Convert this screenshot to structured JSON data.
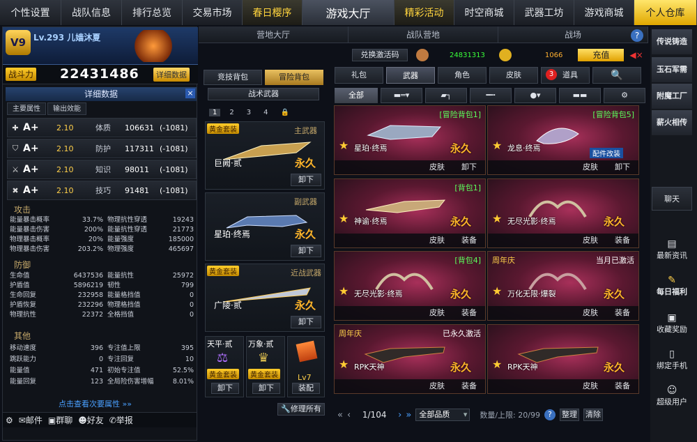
{
  "nav": [
    "个性设置",
    "战队信息",
    "排行总览",
    "交易市场",
    "春日樱序",
    "游戏大厅",
    "精彩活动",
    "时空商城",
    "武器工坊",
    "游戏商城",
    "个人仓库"
  ],
  "player": {
    "level_name": "Lv.293 儿嫱沐夏",
    "power_label": "战斗力",
    "power": "22431486",
    "detail_btn": "详细数据",
    "vip": "V9"
  },
  "detail": {
    "title": "详细数据",
    "tabs": [
      "主要属性",
      "输出效能"
    ],
    "attrs": [
      {
        "grade": "A+",
        "val": "2.10",
        "name": "体质",
        "num": "106631",
        "delta": "(-1081)"
      },
      {
        "grade": "A+",
        "val": "2.10",
        "name": "防护",
        "num": "117311",
        "delta": "(-1081)"
      },
      {
        "grade": "A+",
        "val": "2.10",
        "name": "知识",
        "num": "98011",
        "delta": "(-1081)"
      },
      {
        "grade": "A+",
        "val": "2.10",
        "name": "技巧",
        "num": "91481",
        "delta": "(-1081)"
      }
    ],
    "attack_title": "攻击",
    "attack": [
      [
        "能量暴击概率",
        "33.7%",
        "物理抗性穿透",
        "19243"
      ],
      [
        "能量暴击伤害",
        "200%",
        "能量抗性穿透",
        "21773"
      ],
      [
        "物理暴击概率",
        "20%",
        "能量强度",
        "185000"
      ],
      [
        "物理暴击伤害",
        "203.2%",
        "物理强度",
        "465697"
      ]
    ],
    "defense_title": "防御",
    "defense": [
      [
        "生命值",
        "6437536",
        "能量抗性",
        "25972"
      ],
      [
        "护盾值",
        "5896219",
        "韧性",
        "799"
      ],
      [
        "生命回复",
        "232958",
        "能量格挡值",
        "0"
      ],
      [
        "护盾恢复",
        "232296",
        "物理格挡值",
        "0"
      ],
      [
        "物理抗性",
        "22372",
        "全格挡值",
        "0"
      ]
    ],
    "other_title": "其他",
    "other": [
      [
        "移动速度",
        "396",
        "专注值上限",
        "395"
      ],
      [
        "跳跃能力",
        "0",
        "专注回复",
        "10"
      ],
      [
        "能量值",
        "471",
        "初始专注值",
        "52.5%"
      ],
      [
        "能量回复",
        "123",
        "全局险伤害增幅",
        "8.01%"
      ]
    ],
    "more_link": "点击查看次要属性 »»"
  },
  "bottom_bar": [
    "邮件",
    "群聊",
    "好友",
    "举报"
  ],
  "mid_tabs": [
    "营地大厅",
    "战队营地",
    "战场"
  ],
  "currency": {
    "redeem": "兑换激活码",
    "bp": "24831313",
    "gold": "1066",
    "recharge": "充值"
  },
  "bag": {
    "tabs": [
      "竞技背包",
      "冒险背包"
    ],
    "tactical": "战术武器",
    "pages": [
      "1",
      "2",
      "3",
      "4"
    ],
    "main_label": "主武器",
    "main_set": "黄金套装",
    "main_name": "巨阙·贰",
    "main_perm": "永久",
    "main_btn": "卸下",
    "sec_label": "副武器",
    "sec_name": "星珀·终焉",
    "sec_perm": "永久",
    "sec_btn": "卸下",
    "melee_label": "近战武器",
    "melee_set": "黄金套装",
    "melee_name": "广陵·贰",
    "melee_perm": "永久",
    "melee_btn": "卸下",
    "acc1": "天平·贰",
    "acc1_set": "黄金套装",
    "acc1_btn": "卸下",
    "acc2": "万象·贰",
    "acc2_set": "黄金套装",
    "acc2_btn": "卸下",
    "lv": "Lv7",
    "equip_btn": "装配",
    "repair": "修理所有"
  },
  "inv_tabs": [
    "礼包",
    "武器",
    "角色",
    "皮肤",
    "道具"
  ],
  "inv_badge": "3",
  "filter_all": "全部",
  "items": [
    {
      "name": "星珀·终焉",
      "perm": "永久",
      "tag": "[冒险背包1]",
      "btn1": "皮肤",
      "btn2": "卸下"
    },
    {
      "name": "龙息·终焉",
      "perm": "永久",
      "tag": "[冒险背包5]",
      "btn1": "皮肤",
      "btn2": "卸下",
      "badge": "配件改装"
    },
    {
      "name": "神谕·终焉",
      "perm": "永久",
      "tag": "[背包1]",
      "btn1": "皮肤",
      "btn2": "装备"
    },
    {
      "name": "无尽光影·终焉",
      "perm": "永久",
      "tag": "",
      "btn1": "皮肤",
      "btn2": "装备"
    },
    {
      "name": "无尽光影·终焉",
      "perm": "永久",
      "tag": "[背包4]",
      "btn1": "皮肤",
      "btn2": "装备"
    },
    {
      "name": "万化无限·爆裂",
      "perm": "永久",
      "tagl": "周年庆",
      "tagw": "当月已激活",
      "btn1": "皮肤",
      "btn2": "装备"
    },
    {
      "name": "RPK天神",
      "perm": "永久",
      "tagl": "周年庆",
      "tagw": "已永久激活",
      "btn1": "皮肤",
      "btn2": "装备"
    },
    {
      "name": "RPK天神",
      "perm": "永久",
      "tag": "",
      "btn1": "皮肤",
      "btn2": "装备"
    }
  ],
  "pager": {
    "page": "1/104",
    "quality": "全部品质",
    "count": "数量/上限: 20/99",
    "sort": "整理",
    "clear": "清除"
  },
  "right": [
    "传说铸造",
    "玉石军需",
    "附魔工厂",
    "薪火相传",
    "聊天",
    "最新资讯",
    "每日福利",
    "收藏奖励",
    "绑定手机",
    "超级用户"
  ]
}
